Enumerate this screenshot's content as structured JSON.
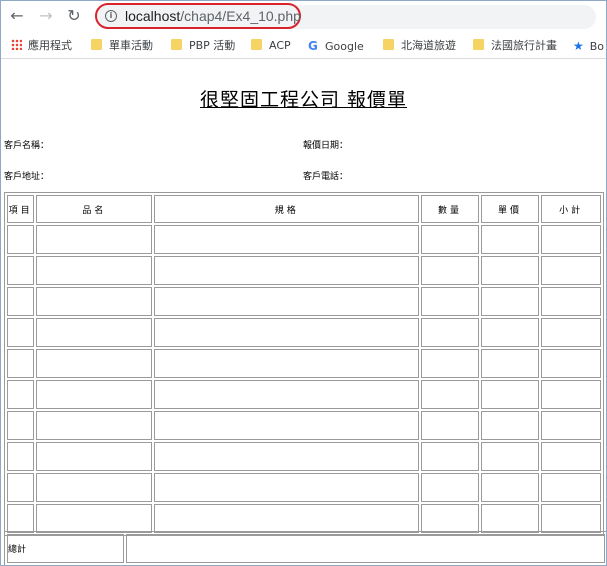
{
  "browser": {
    "url_host": "localhost",
    "url_path": "/chap4/Ex4_10.php",
    "bookmarks": [
      {
        "label": "應用程式",
        "icon": "apps-grid-icon"
      },
      {
        "label": "單車活動",
        "icon": "folder-icon"
      },
      {
        "label": "PBP 活動",
        "icon": "folder-icon"
      },
      {
        "label": "ACP",
        "icon": "folder-icon"
      },
      {
        "label": "Google",
        "icon": "google-icon"
      },
      {
        "label": "北海道旅遊",
        "icon": "folder-icon"
      },
      {
        "label": "法國旅行計畫",
        "icon": "folder-icon"
      },
      {
        "label": "Bo",
        "icon": "star-icon"
      }
    ]
  },
  "document": {
    "title": "很堅固工程公司 報價單",
    "customer_name_label": "客戶名稱：",
    "quote_date_label": "報價日期：",
    "customer_address_label": "客戶地址：",
    "customer_phone_label": "客戶電話：",
    "table": {
      "headers": [
        "項目",
        "品名",
        "規格",
        "數量",
        "單價",
        "小計"
      ],
      "rows": [
        [
          "",
          "",
          "",
          "",
          "",
          ""
        ],
        [
          "",
          "",
          "",
          "",
          "",
          ""
        ],
        [
          "",
          "",
          "",
          "",
          "",
          ""
        ],
        [
          "",
          "",
          "",
          "",
          "",
          ""
        ],
        [
          "",
          "",
          "",
          "",
          "",
          ""
        ],
        [
          "",
          "",
          "",
          "",
          "",
          ""
        ],
        [
          "",
          "",
          "",
          "",
          "",
          ""
        ],
        [
          "",
          "",
          "",
          "",
          "",
          ""
        ],
        [
          "",
          "",
          "",
          "",
          "",
          ""
        ],
        [
          "",
          "",
          "",
          "",
          "",
          ""
        ]
      ]
    },
    "total_label": "總計",
    "total_value": ""
  },
  "colors": {
    "url_highlight": "#d9232d",
    "folder": "#f6d365",
    "table_border": "#9a9a9a"
  }
}
